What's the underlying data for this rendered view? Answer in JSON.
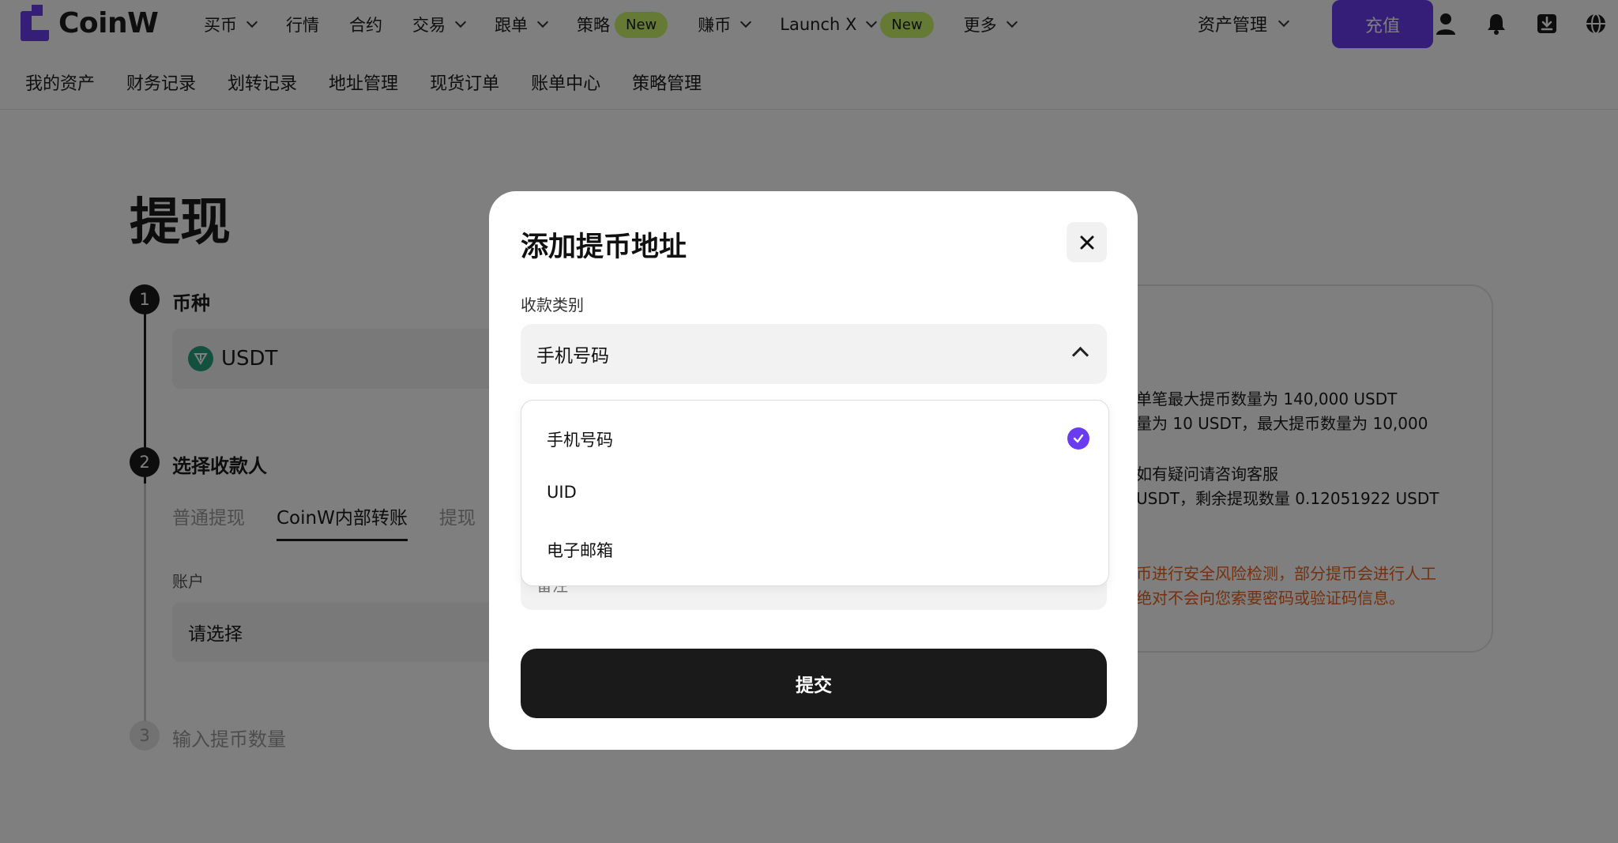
{
  "brand": {
    "name": "CoinW",
    "accent": "#6a3cf0",
    "badge_color": "#c9f56a"
  },
  "topnav": {
    "items": [
      {
        "label": "买币",
        "has_chevron": true
      },
      {
        "label": "行情",
        "has_chevron": false
      },
      {
        "label": "合约",
        "has_chevron": false
      },
      {
        "label": "交易",
        "has_chevron": true
      },
      {
        "label": "跟单",
        "has_chevron": true
      },
      {
        "label": "策略",
        "badge": "New"
      },
      {
        "label": "赚币",
        "has_chevron": true
      },
      {
        "label": "Launch X",
        "has_chevron": true,
        "badge": "New"
      },
      {
        "label": "更多",
        "has_chevron": true
      }
    ],
    "asset_management": "资产管理",
    "deposit_button": "充值",
    "icons": [
      "user-icon",
      "bell-icon",
      "download-icon",
      "globe-icon"
    ]
  },
  "subnav": {
    "items": [
      "我的资产",
      "财务记录",
      "划转记录",
      "地址管理",
      "现货订单",
      "账单中心",
      "策略管理"
    ]
  },
  "page": {
    "title": "提现",
    "steps": [
      {
        "number": "1",
        "label": "币种"
      },
      {
        "number": "2",
        "label": "选择收款人"
      },
      {
        "number": "3",
        "label": "输入提币数量"
      }
    ],
    "coin": "USDT",
    "tabs": [
      "普通提现",
      "CoinW内部转账",
      "提现"
    ],
    "account_label": "账户",
    "account_placeholder": "请选择"
  },
  "info_card": {
    "lines": [
      "单笔最大提币数量为 140,000 USDT",
      "量为 10 USDT，最大提币数量为 10,000",
      "",
      "如有疑问请咨询客服",
      "USDT，剩余提现数量 0.12051922 USDT"
    ],
    "warnings": [
      "币进行安全风险检测，部分提币会进行人工",
      "绝对不会向您索要密码或验证码信息。"
    ],
    "warning_color": "#e8621e"
  },
  "modal": {
    "title": "添加提币地址",
    "category_label": "收款类别",
    "selected_value": "手机号码",
    "options": [
      {
        "label": "手机号码",
        "selected": true
      },
      {
        "label": "UID",
        "selected": false
      },
      {
        "label": "电子邮箱",
        "selected": false
      }
    ],
    "remark_placeholder": "备注",
    "submit_label": "提交"
  }
}
